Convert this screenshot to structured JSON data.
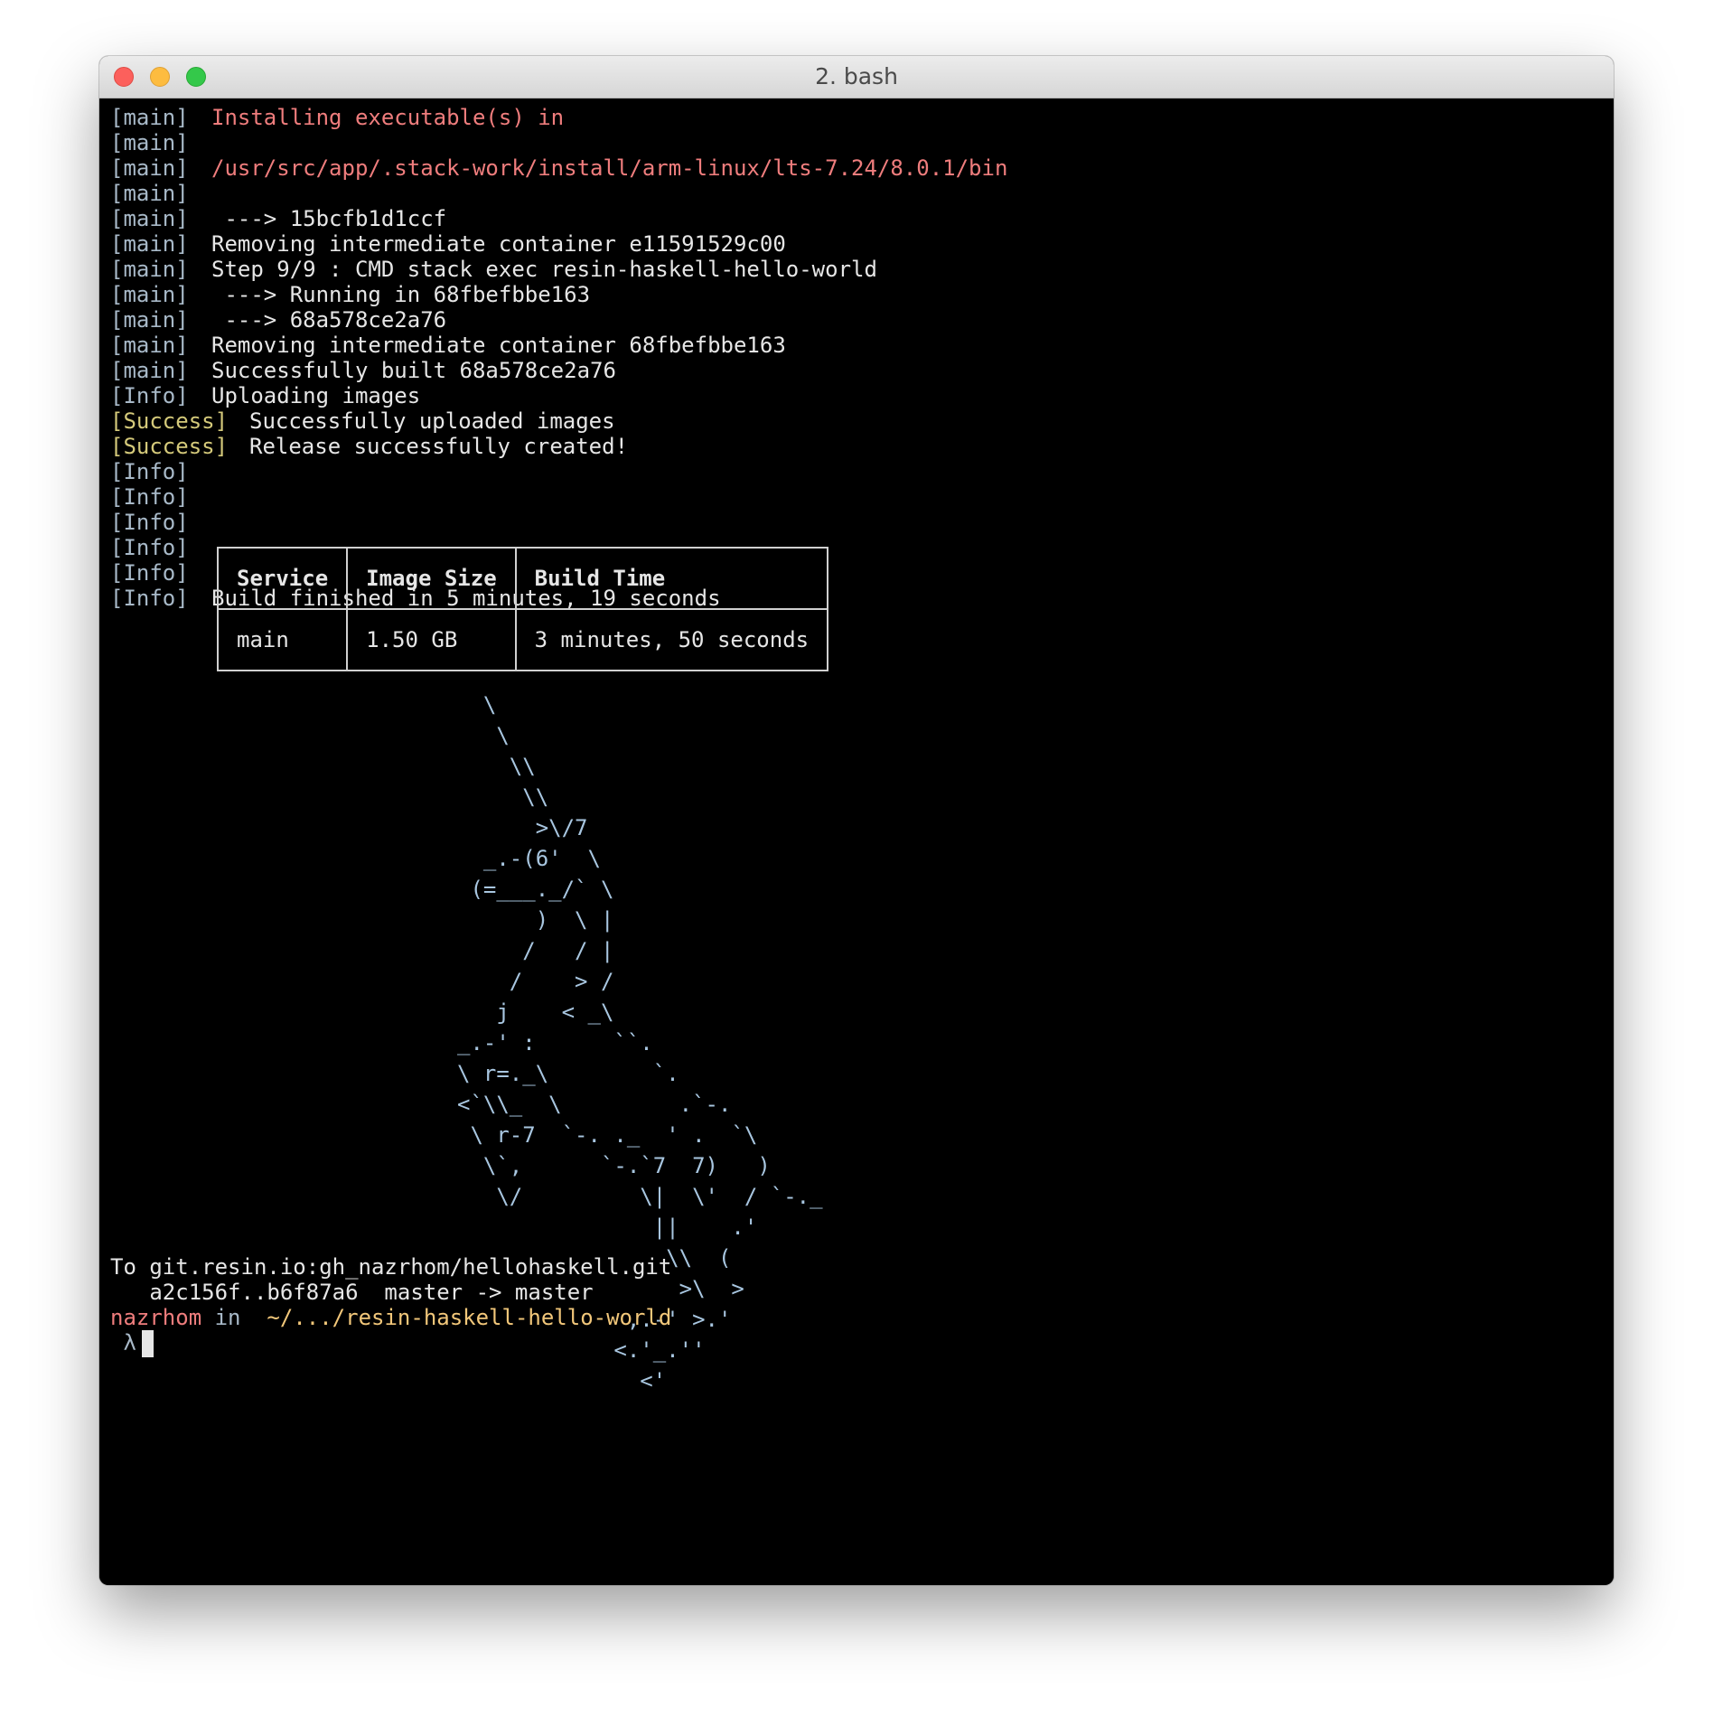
{
  "window": {
    "title": "2. bash",
    "buttons": {
      "close": "close",
      "minimize": "minimize",
      "zoom": "zoom"
    }
  },
  "log": [
    {
      "tag": "[main]",
      "text": "Installing executable(s) in",
      "style": "pink"
    },
    {
      "tag": "[main]",
      "text": "",
      "style": ""
    },
    {
      "tag": "[main]",
      "text": "/usr/src/app/.stack-work/install/arm-linux/lts-7.24/8.0.1/bin",
      "style": "pink"
    },
    {
      "tag": "[main]",
      "text": "",
      "style": ""
    },
    {
      "tag": "[main]",
      "text": " ---> 15bcfb1d1ccf",
      "style": ""
    },
    {
      "tag": "[main]",
      "text": "Removing intermediate container e11591529c00",
      "style": ""
    },
    {
      "tag": "[main]",
      "text": "Step 9/9 : CMD stack exec resin-haskell-hello-world",
      "style": ""
    },
    {
      "tag": "[main]",
      "text": " ---> Running in 68fbefbbe163",
      "style": ""
    },
    {
      "tag": "[main]",
      "text": " ---> 68a578ce2a76",
      "style": ""
    },
    {
      "tag": "[main]",
      "text": "Removing intermediate container 68fbefbbe163",
      "style": ""
    },
    {
      "tag": "[main]",
      "text": "Successfully built 68a578ce2a76",
      "style": ""
    },
    {
      "tag": "[Info]",
      "text": "Uploading images",
      "style": ""
    },
    {
      "tag": "[Success]",
      "text": "Successfully uploaded images",
      "style": "success"
    },
    {
      "tag": "[Success]",
      "text": "Release successfully created!",
      "style": "success"
    },
    {
      "tag": "[Info]",
      "text": "",
      "style": ""
    },
    {
      "tag": "[Info]",
      "text": "",
      "style": ""
    },
    {
      "tag": "[Info]",
      "text": "",
      "style": ""
    },
    {
      "tag": "[Info]",
      "text": "",
      "style": ""
    },
    {
      "tag": "[Info]",
      "text": "",
      "style": ""
    },
    {
      "tag": "[Info]",
      "text": "Build finished in 5 minutes, 19 seconds",
      "style": ""
    }
  ],
  "summary_table": {
    "headers": [
      "Service",
      "Image Size",
      "Build Time"
    ],
    "rows": [
      [
        "main",
        "1.50 GB",
        "3 minutes, 50 seconds"
      ]
    ]
  },
  "unicorn_art": [
    "  \\",
    "   \\",
    "    \\\\",
    "     \\\\",
    "      >\\/7",
    "  _.-(6'  \\",
    " (=___._/` \\",
    "      )  \\ |",
    "     /   / |",
    "    /    > /",
    "   j    < _\\",
    "_.-' :      ``.",
    "\\ r=._\\        `.",
    "<`\\\\_  \\         .`-.",
    " \\ r-7  `-. ._  ' .  `\\",
    "  \\`,      `-.`7  7)   )",
    "   \\/         \\|  \\'  / `-._",
    "               ||    .'",
    "                \\\\  (",
    "                 >\\  >",
    "             ,.-' >.'",
    "            <.'_.''",
    "              <'"
  ],
  "git": {
    "remote_line": "To git.resin.io:gh_nazrhom/hellohaskell.git",
    "push_line": "   a2c156f..b6f87a6  master -> master"
  },
  "prompt": {
    "user": "nazrhom",
    "in_word": "in",
    "path": "~/.../resin-haskell-hello-world",
    "symbol": "λ"
  },
  "colors": {
    "terminal_background": "#000000",
    "default_text": "#e6e6e6",
    "tag": "#a8b9c8",
    "success_tag": "#d4c97a",
    "highlight_pink": "#ef7d7d",
    "path_yellow": "#f2c77a",
    "ascii_art": "#a8c6e0"
  }
}
